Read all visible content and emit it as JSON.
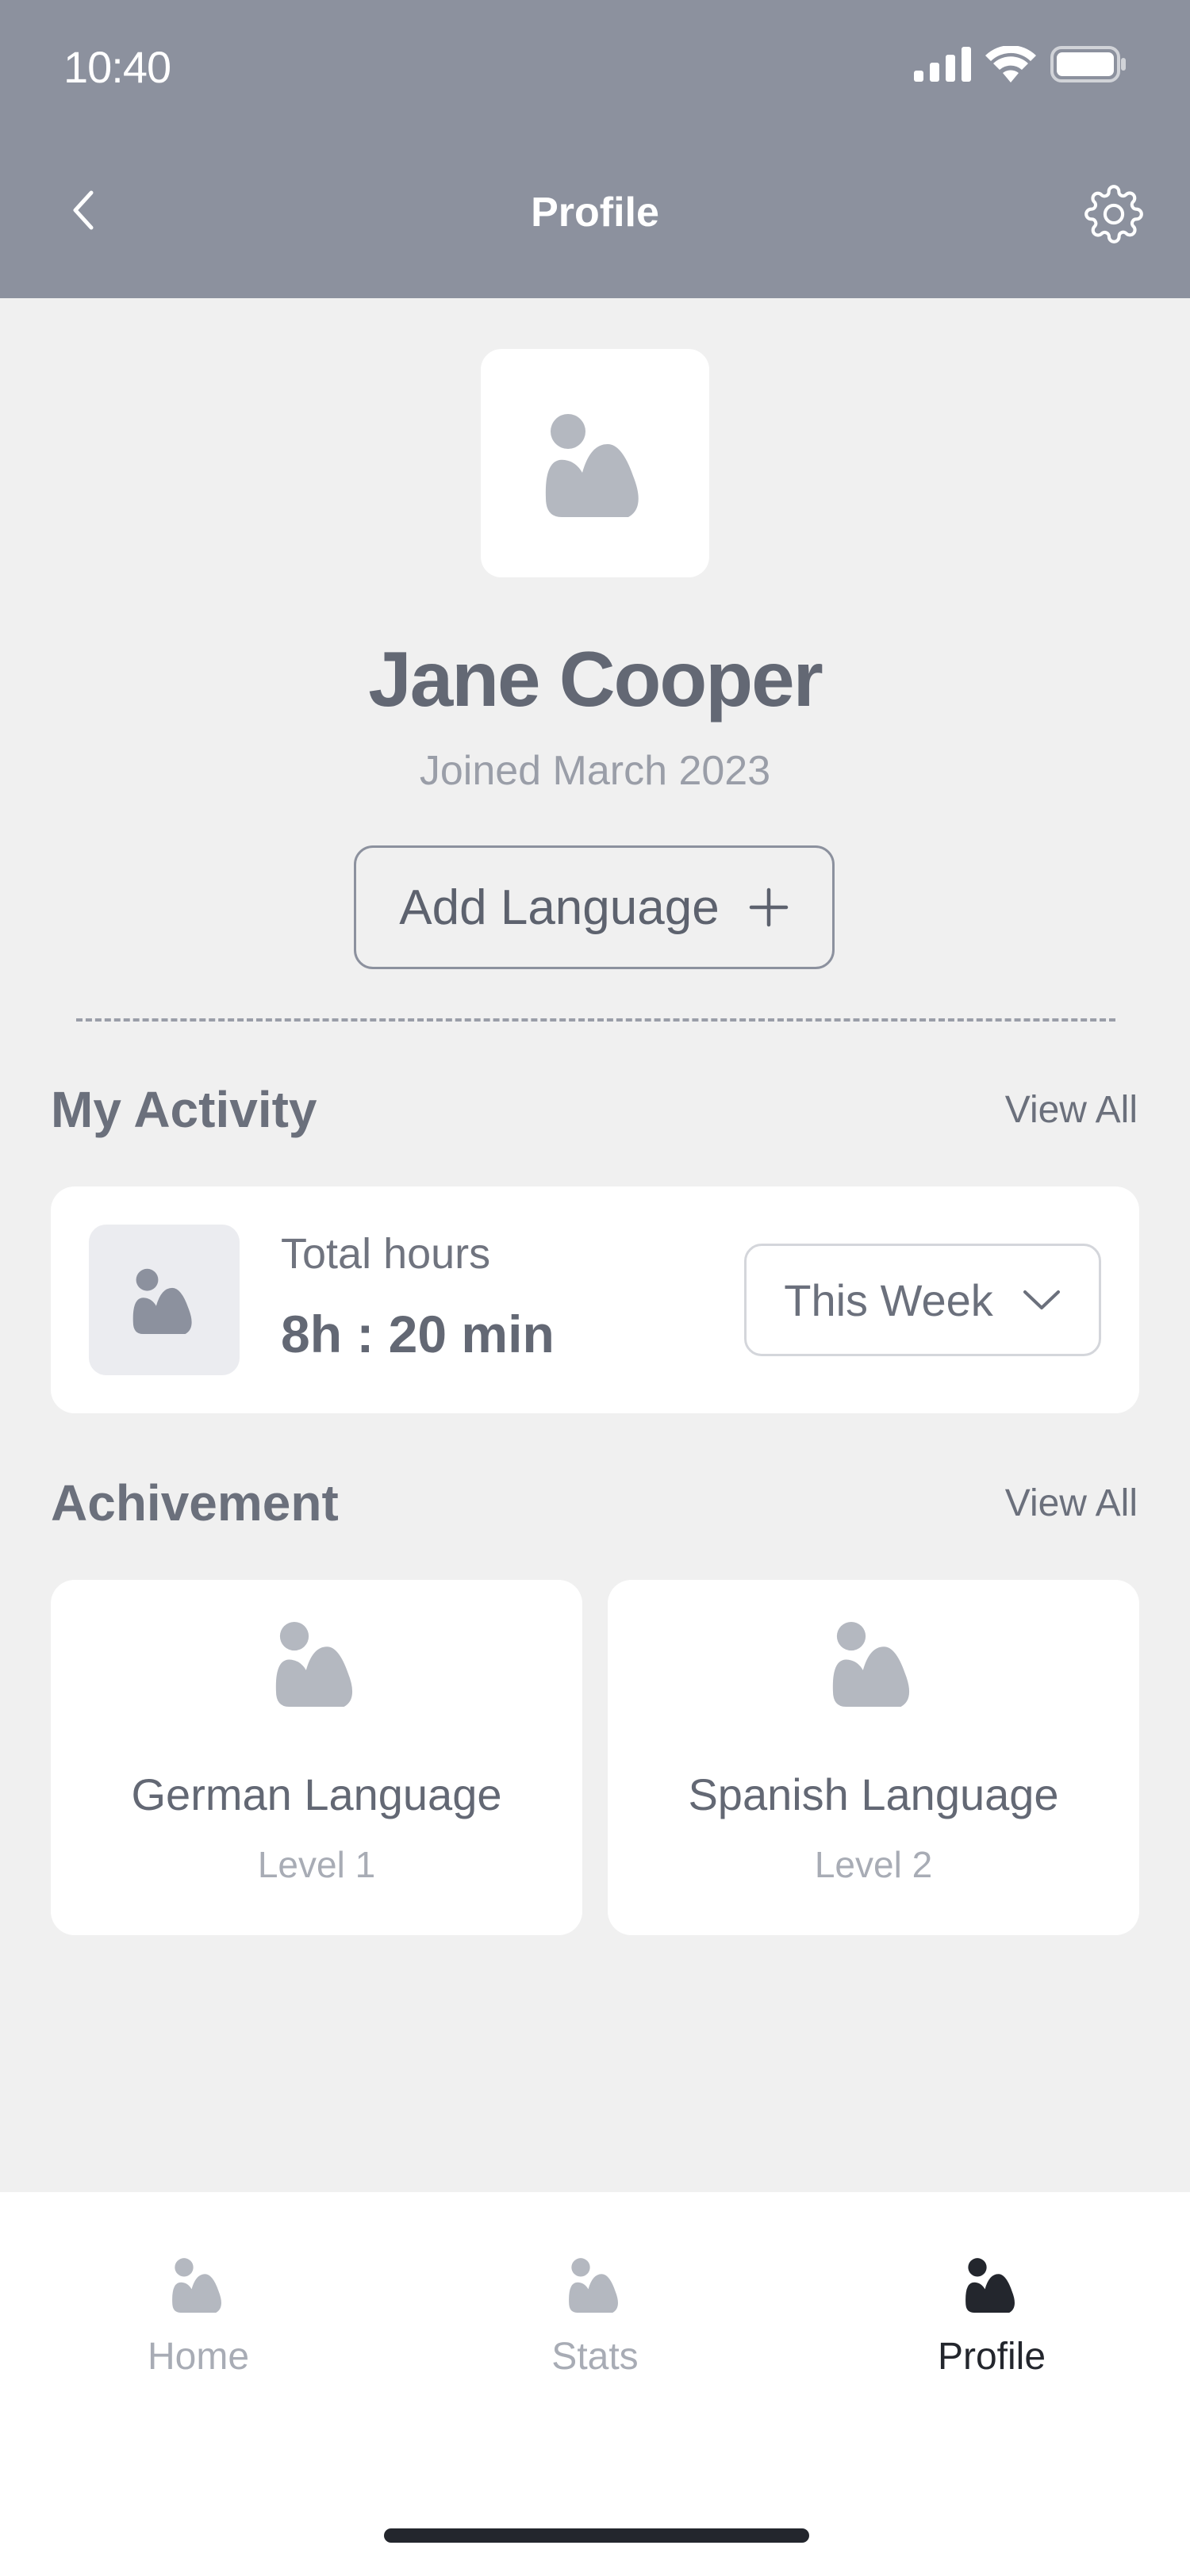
{
  "status_bar": {
    "time": "10:40"
  },
  "nav": {
    "title": "Profile"
  },
  "profile": {
    "name": "Jane Cooper",
    "joined": "Joined March 2023",
    "add_language_label": "Add Language"
  },
  "activity": {
    "title": "My Activity",
    "view_all": "View All",
    "total_label": "Total hours",
    "total_value": "8h : 20 min",
    "period_selected": "This Week"
  },
  "achievement": {
    "title": "Achivement",
    "view_all": "View All",
    "items": [
      {
        "title": "German Language",
        "level": "Level 1"
      },
      {
        "title": "Spanish Language",
        "level": "Level 2"
      }
    ]
  },
  "tabbar": {
    "tabs": [
      {
        "label": "Home",
        "active": false
      },
      {
        "label": "Stats",
        "active": false
      },
      {
        "label": "Profile",
        "active": true
      }
    ]
  },
  "colors": {
    "header_bg": "#8c919e",
    "page_bg": "#f0f0f0",
    "placeholder_icon": "#b4b8c0",
    "active_tab": "#23262d"
  }
}
